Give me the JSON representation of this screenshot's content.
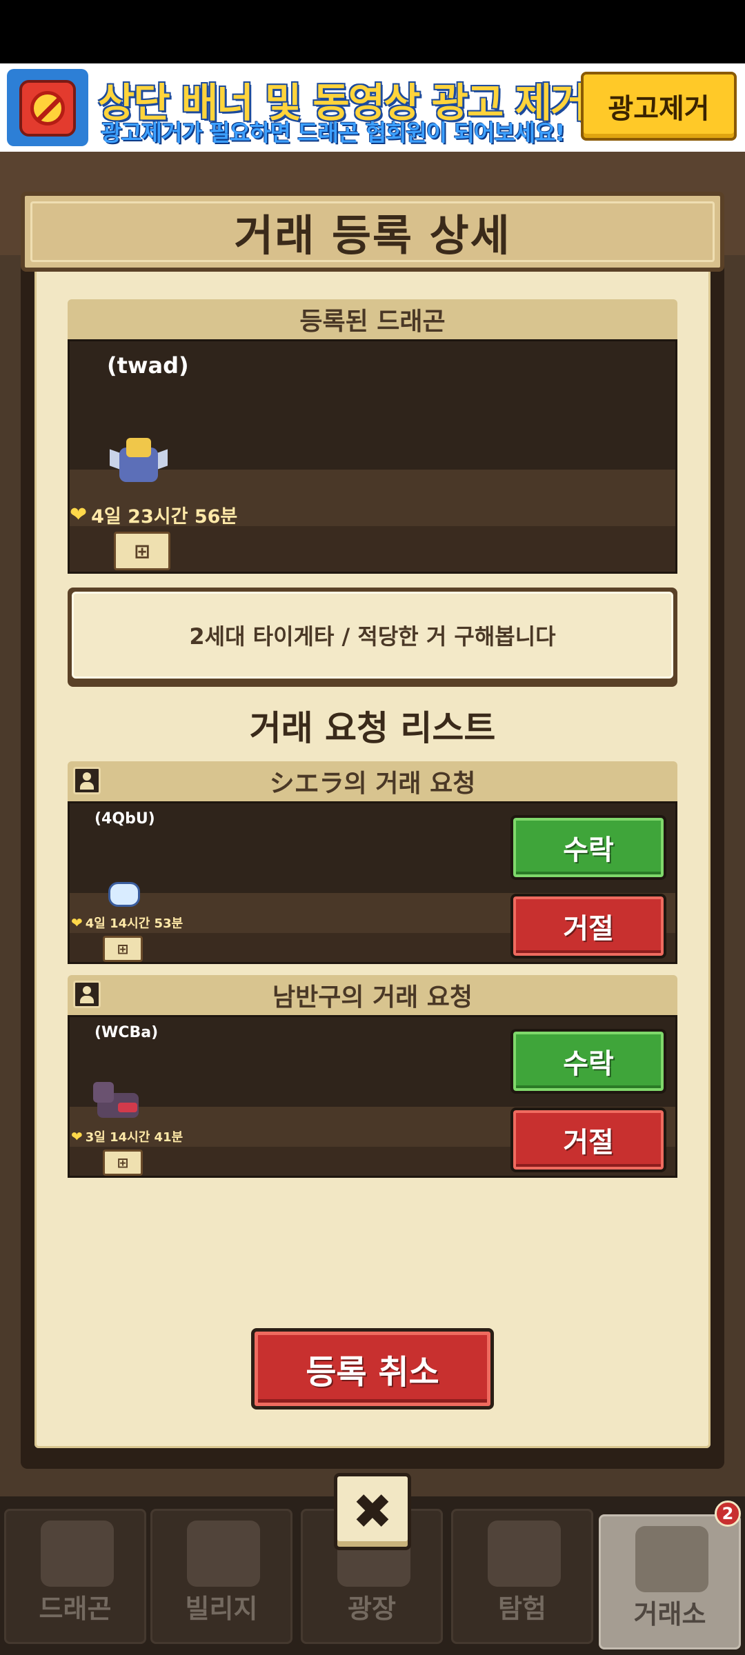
{
  "ad": {
    "title": "상단 배너 및 동영상 광고 제거!",
    "subtitle": "광고제거가 필요하면 드래곤 협회원이 되어보세요!",
    "remove_button": "광고제거",
    "icon": "no-ads-clock-icon"
  },
  "modal": {
    "title": "거래 등록 상세",
    "registered_section": "등록된 드래곤",
    "registered_dragon": {
      "nickname": "(twad)",
      "time_left": "4일 23시간 56분",
      "tree_icon": "family-tree-icon"
    },
    "message": "2세대 타이게타 / 적당한 거 구해봅니다",
    "request_list_title": "거래 요청 리스트",
    "requests": [
      {
        "header": "シエラ의 거래 요청",
        "nickname": "(4QbU)",
        "time_left": "4일 14시간 53분",
        "accept": "수락",
        "reject": "거절"
      },
      {
        "header": "남반구의 거래 요청",
        "nickname": "(WCBa)",
        "time_left": "3일 14시간 41분",
        "accept": "수락",
        "reject": "거절"
      }
    ],
    "cancel_button": "등록 취소",
    "close_icon": "close-icon",
    "close_glyph": "✖"
  },
  "nav": {
    "items": [
      "드래곤",
      "빌리지",
      "광장",
      "탐험",
      "거래소"
    ],
    "active": "거래소",
    "badge": "2"
  },
  "colors": {
    "accept": "#3fa53a",
    "reject": "#c8302f",
    "panel": "#f2e7c4",
    "ad_yellow": "#ffc928"
  }
}
